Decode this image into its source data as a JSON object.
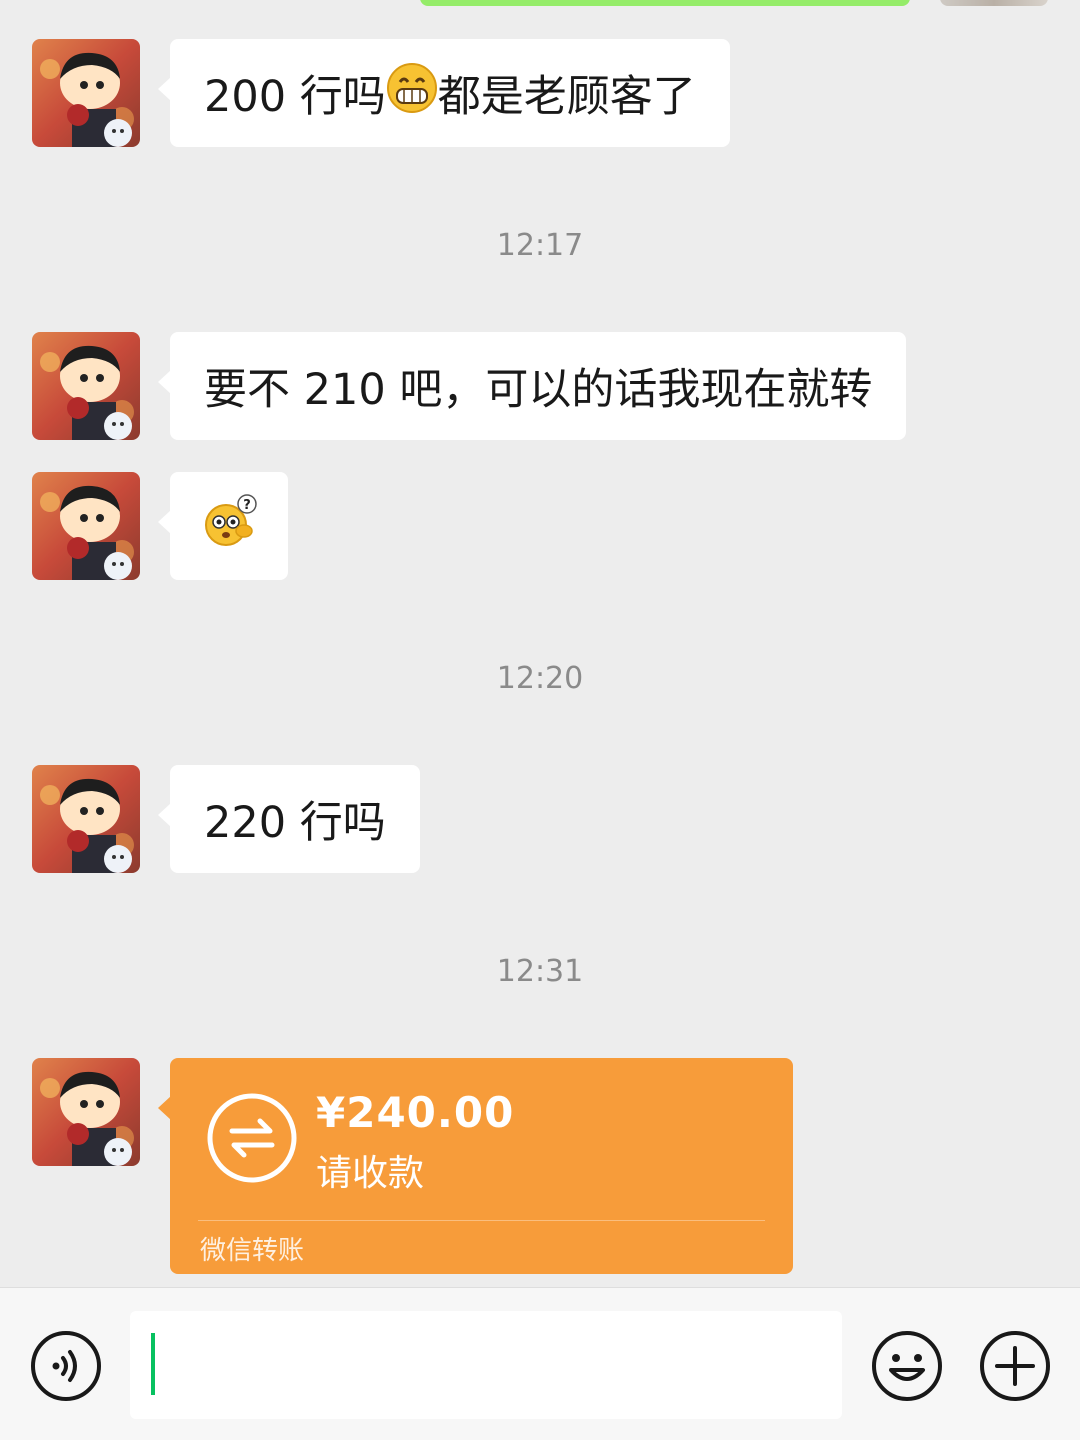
{
  "messages": [
    {
      "type": "text",
      "text_before": "200 行吗",
      "emoji": "grin-emoji",
      "text_after": "都是老顾客了"
    },
    {
      "type": "time",
      "text": "12:17"
    },
    {
      "type": "text",
      "text": "要不 210 吧，可以的话我现在就转"
    },
    {
      "type": "emoji",
      "emoji": "confused-question-emoji"
    },
    {
      "type": "time",
      "text": "12:20"
    },
    {
      "type": "text",
      "text": "220 行吗"
    },
    {
      "type": "time",
      "text": "12:31"
    },
    {
      "type": "transfer",
      "amount": "¥240.00",
      "status": "请收款",
      "label": "微信转账",
      "icon": "transfer-arrows-icon"
    }
  ],
  "input_bar": {
    "voice_icon": "voice-icon",
    "emoji_icon": "smiley-icon",
    "more_icon": "plus-icon",
    "value": ""
  },
  "colors": {
    "background": "#ededed",
    "incoming_bubble": "#ffffff",
    "outgoing_bubble": "#95ec69",
    "transfer_card": "#f79c3a",
    "caret": "#07c160"
  }
}
